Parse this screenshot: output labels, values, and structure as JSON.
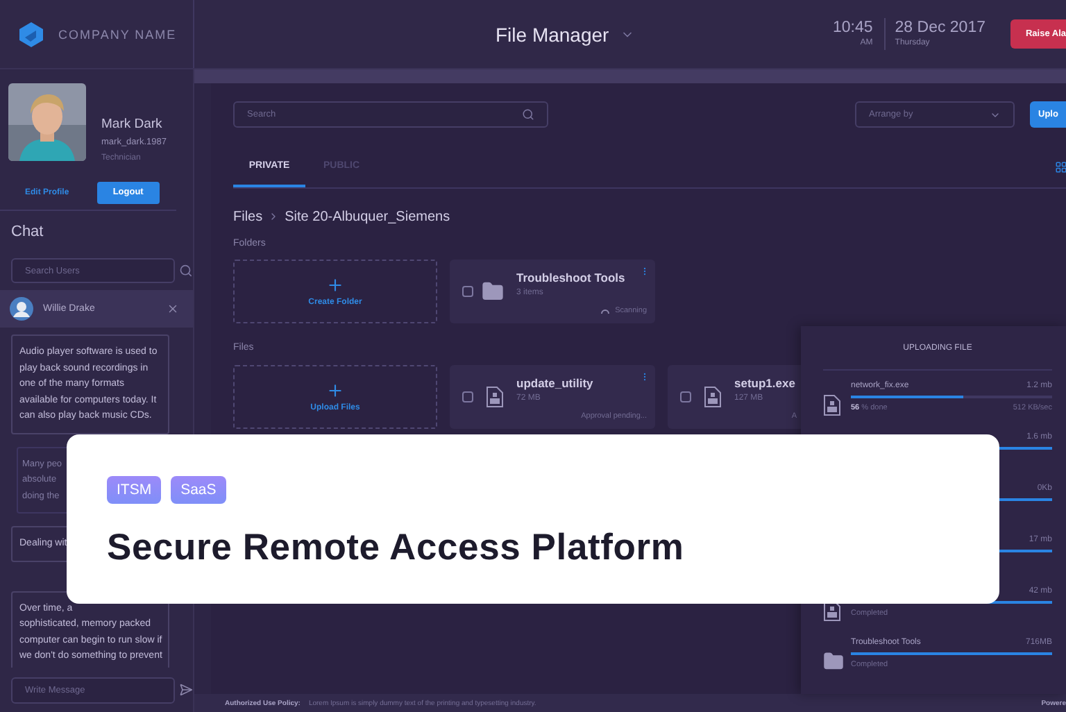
{
  "header": {
    "company": "COMPANY NAME",
    "title": "File Manager",
    "time": "10:45",
    "meridiem": "AM",
    "date": "28 Dec 2017",
    "weekday": "Thursday",
    "alarm_button": "Raise Ala"
  },
  "profile": {
    "name": "Mark Dark",
    "username": "mark_dark.1987",
    "role": "Technician",
    "edit_link": "Edit Profile",
    "logout_button": "Logout"
  },
  "chat": {
    "title": "Chat",
    "search_placeholder": "Search Users",
    "contact": "Willie Drake",
    "messages": [
      {
        "kind": "received",
        "text": "Audio player software is used to play back sound recordings in one of the many formats available for computers today. It can also play back music CDs."
      },
      {
        "kind": "sent",
        "lines": [
          "Many peo",
          "absolute",
          "doing the"
        ]
      },
      {
        "kind": "received",
        "lines": [
          "Dealing wit"
        ]
      },
      {
        "kind": "received",
        "lines": [
          "Over time, a",
          "sophisticated, memory packed",
          "computer can begin to run slow if",
          "we don't do something to prevent"
        ]
      }
    ],
    "compose_placeholder": "Write Message"
  },
  "main": {
    "search_placeholder": "Search",
    "arrange_placeholder": "Arrange by",
    "upload_button": "Uplo",
    "tabs": [
      {
        "label": "PRIVATE",
        "selected": true
      },
      {
        "label": "PUBLIC",
        "selected": false
      }
    ],
    "breadcrumb": [
      "Files",
      "Site 20-Albuquer_Siemens"
    ],
    "folders_label": "Folders",
    "create_folder": "Create Folder",
    "folders": [
      {
        "name": "Troubleshoot Tools",
        "meta": "3 items",
        "status": "Scanning",
        "checked": false
      }
    ],
    "files_label": "Files",
    "upload_files": "Upload Files",
    "files": [
      {
        "name": "update_utility",
        "size": "72 MB",
        "status": "Approval pending...",
        "checked": false
      },
      {
        "name": "setup1.exe",
        "size": "127 MB",
        "status": "A",
        "checked": false
      }
    ]
  },
  "upload_panel": {
    "title": "UPLOADING FILE",
    "items": [
      {
        "kind": "file",
        "name": "network_fix.exe",
        "size": "1.2 mb",
        "level": 0.56,
        "percent": "56",
        "percent_suffix": "% done",
        "speed": "512 KB/sec"
      },
      {
        "kind": "covered",
        "size": "1.6 mb",
        "level": 1
      },
      {
        "kind": "covered",
        "size": "0Kb",
        "level": 1
      },
      {
        "kind": "covered",
        "size": "17 mb",
        "level": 1
      },
      {
        "kind": "file",
        "size": "42 mb",
        "level": 1,
        "status": "Completed"
      },
      {
        "kind": "folder",
        "name": "Troubleshoot Tools",
        "size": "716MB",
        "level": 1,
        "status": "Completed"
      }
    ]
  },
  "footer": {
    "policy_label": "Authorized Use Policy:",
    "policy_text": "Lorem Ipsum is simply dummy text of the printing and typesetting industry.",
    "powered": "Powere"
  },
  "overlay_card": {
    "tags": [
      "ITSM",
      "SaaS"
    ],
    "title": "Secure Remote Access Platform"
  }
}
